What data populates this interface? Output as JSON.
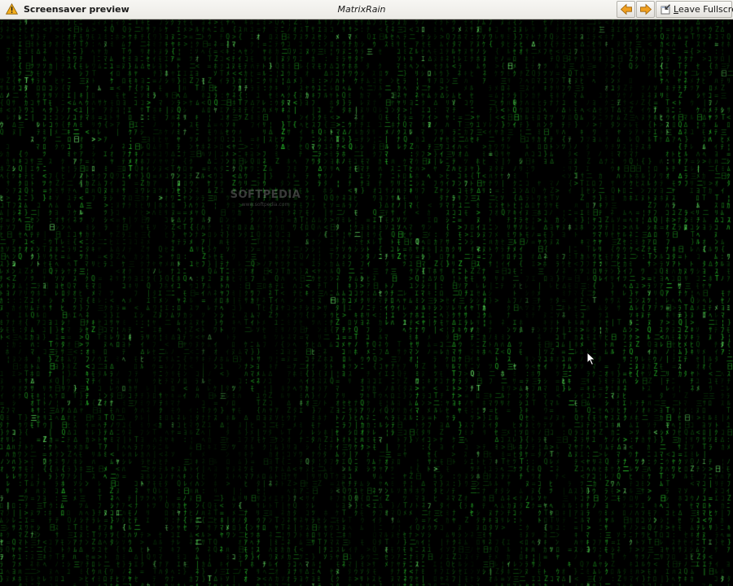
{
  "toolbar": {
    "preview_title": "Screensaver preview",
    "saver_name": "MatrixRain",
    "prev_icon": "arrow-left-icon",
    "next_icon": "arrow-right-icon",
    "leave_icon": "leave-fullscreen-icon",
    "leave_mnemonic": "L",
    "leave_rest": "eave Fullscreen",
    "warning_icon": "warning-icon"
  },
  "watermark": {
    "name": "SOFTPEDIA",
    "url": "www.softpedia.com"
  },
  "colors": {
    "toolbar_bg": "#ecebe6",
    "nav_arrow": "#f0a020",
    "warning": "#f5b01c",
    "matrix_green": "#2ec83a",
    "matrix_bright": "#6cff6c",
    "background": "#000000"
  }
}
